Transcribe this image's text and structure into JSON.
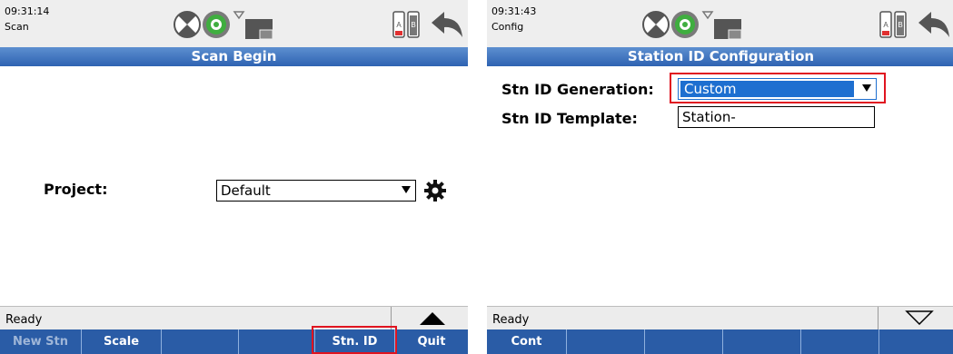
{
  "left_screen": {
    "time": "09:31:14",
    "mode": "Scan",
    "title": "Scan Begin",
    "project_label": "Project:",
    "project_value": "Default",
    "status_text": "Ready",
    "softkeys": [
      {
        "label": "New Stn",
        "enabled": false
      },
      {
        "label": "Scale",
        "enabled": true
      },
      {
        "label": "",
        "enabled": true
      },
      {
        "label": "",
        "enabled": true
      },
      {
        "label": "Stn. ID",
        "enabled": true
      },
      {
        "label": "Quit",
        "enabled": true
      }
    ],
    "icons": [
      "scanner-icon",
      "target-icon",
      "wifi-icon",
      "screen-icon",
      "battery-icon",
      "back-icon",
      "gear-icon",
      "triangle-up-icon"
    ]
  },
  "right_screen": {
    "time": "09:31:43",
    "mode": "Config",
    "title": "Station ID Configuration",
    "generation_label": "Stn ID Generation:",
    "generation_value": "Custom",
    "template_label": "Stn ID Template:",
    "template_value": "Station-",
    "status_text": "Ready",
    "softkeys": [
      {
        "label": "Cont",
        "enabled": true
      },
      {
        "label": "",
        "enabled": true
      },
      {
        "label": "",
        "enabled": true
      },
      {
        "label": "",
        "enabled": true
      },
      {
        "label": "",
        "enabled": true
      },
      {
        "label": "",
        "enabled": true
      }
    ],
    "icons": [
      "scanner-icon",
      "target-icon",
      "wifi-icon",
      "screen-icon",
      "battery-icon",
      "back-icon",
      "triangle-down-icon"
    ]
  },
  "colors": {
    "title_bar": "#2e63b2",
    "softkey_bar": "#2a5ca6",
    "selection": "#1e6fd0",
    "highlight_box": "#e01420"
  }
}
